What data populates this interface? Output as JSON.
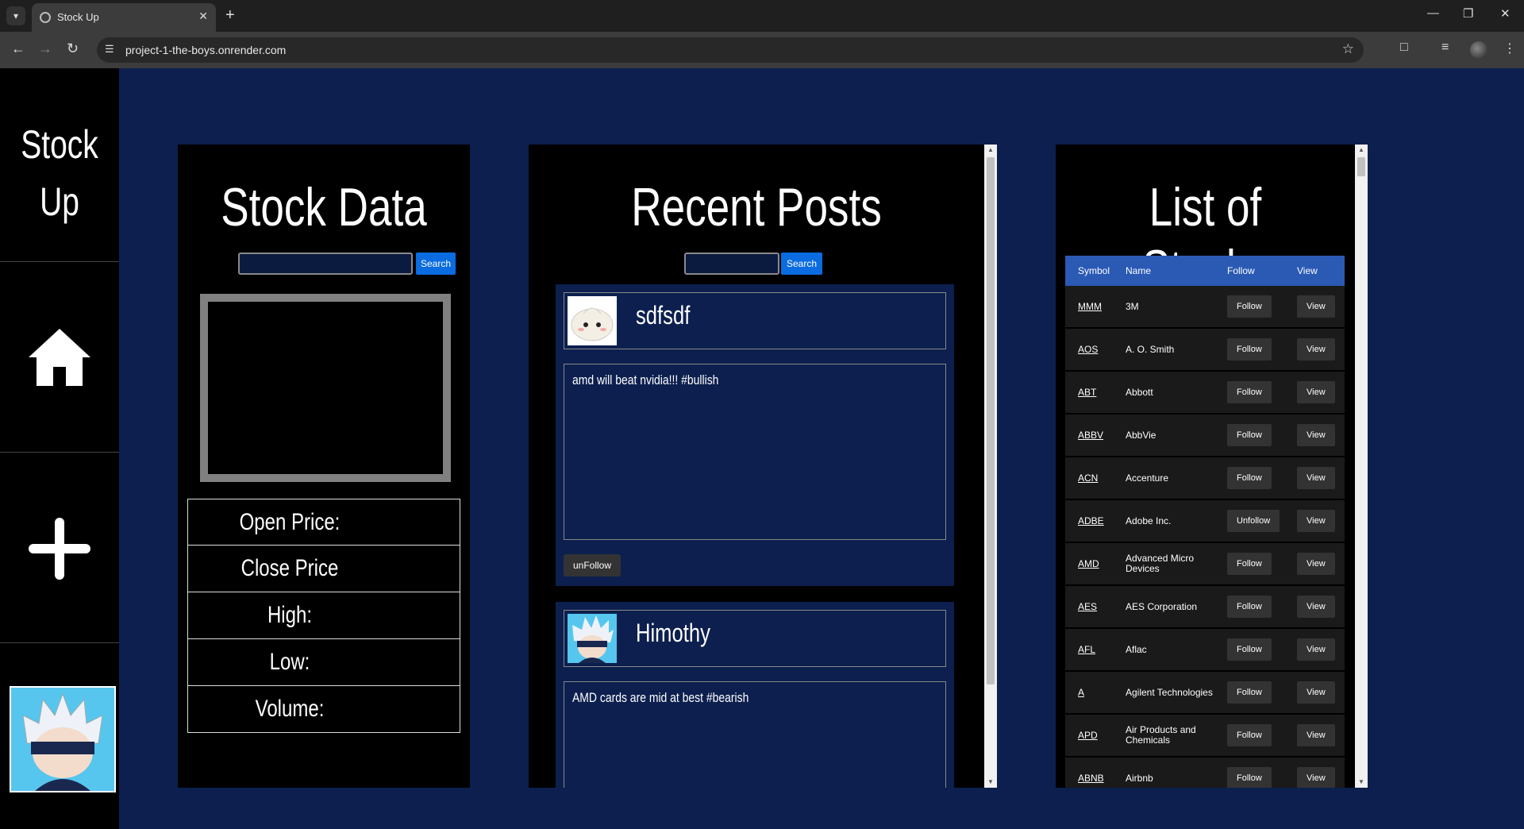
{
  "browser": {
    "tab_title": "Stock Up",
    "url": "project-1-the-boys.onrender.com"
  },
  "sidebar": {
    "brand_line1": "Stock",
    "brand_line2": "Up",
    "items": [
      {
        "icon": "home-icon"
      },
      {
        "icon": "plus-icon"
      }
    ]
  },
  "stock_data": {
    "title": "Stock Data",
    "search_label": "Search",
    "search_value": "",
    "rows": [
      "Open Price:",
      "Close Price",
      "High:",
      "Low:",
      "Volume:"
    ]
  },
  "posts": {
    "title": "Recent Posts",
    "search_label": "Search",
    "search_value": "",
    "items": [
      {
        "user": "sdfsdf",
        "text": "amd will beat nvidia!!! #bullish",
        "button": "unFollow"
      },
      {
        "user": "Himothy",
        "text": "AMD cards are mid at best #bearish"
      }
    ]
  },
  "stocks": {
    "title": "List of Stocks",
    "headers": {
      "symbol": "Symbol",
      "name": "Name",
      "follow": "Follow",
      "view": "View"
    },
    "rows": [
      {
        "symbol": "MMM",
        "name": "3M",
        "follow": "Follow",
        "view": "View"
      },
      {
        "symbol": "AOS",
        "name": "A. O. Smith",
        "follow": "Follow",
        "view": "View"
      },
      {
        "symbol": "ABT",
        "name": "Abbott",
        "follow": "Follow",
        "view": "View"
      },
      {
        "symbol": "ABBV",
        "name": "AbbVie",
        "follow": "Follow",
        "view": "View"
      },
      {
        "symbol": "ACN",
        "name": "Accenture",
        "follow": "Follow",
        "view": "View"
      },
      {
        "symbol": "ADBE",
        "name": "Adobe Inc.",
        "follow": "Unfollow",
        "view": "View"
      },
      {
        "symbol": "AMD",
        "name": "Advanced Micro Devices",
        "follow": "Follow",
        "view": "View"
      },
      {
        "symbol": "AES",
        "name": "AES Corporation",
        "follow": "Follow",
        "view": "View"
      },
      {
        "symbol": "AFL",
        "name": "Aflac",
        "follow": "Follow",
        "view": "View"
      },
      {
        "symbol": "A",
        "name": "Agilent Technologies",
        "follow": "Follow",
        "view": "View"
      },
      {
        "symbol": "APD",
        "name": "Air Products and Chemicals",
        "follow": "Follow",
        "view": "View"
      },
      {
        "symbol": "ABNB",
        "name": "Airbnb",
        "follow": "Follow",
        "view": "View"
      }
    ]
  }
}
